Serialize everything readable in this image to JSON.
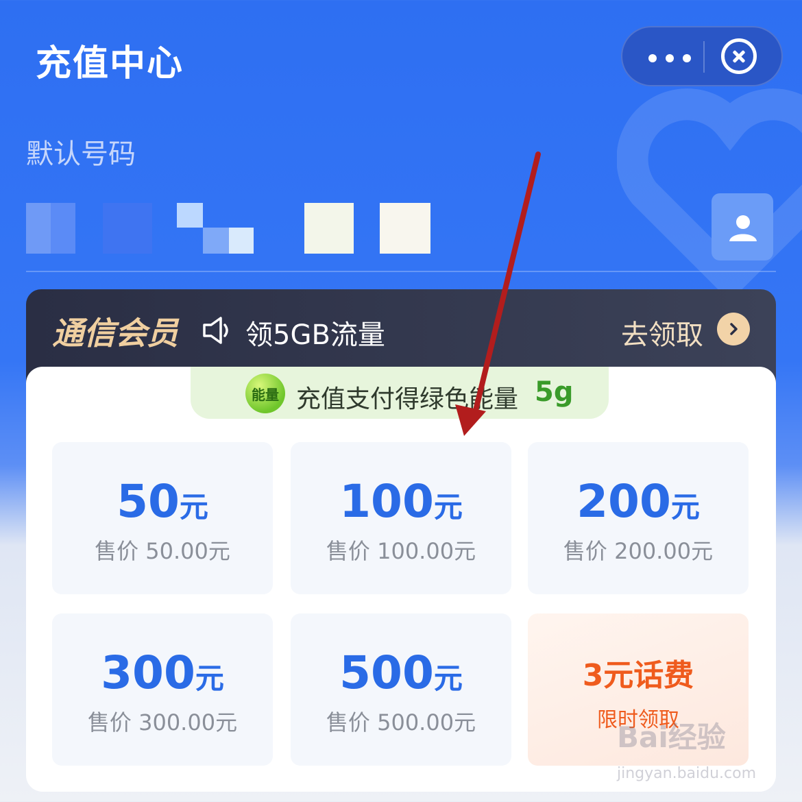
{
  "header": {
    "title": "充值中心"
  },
  "phone": {
    "label": "默认号码"
  },
  "member": {
    "title": "通信会员",
    "promo": "领5GB流量",
    "cta": "去领取"
  },
  "energy": {
    "text": "充值支付得绿色能量",
    "value": "5g",
    "icon_label": "能量"
  },
  "tiles": [
    {
      "amount": "50",
      "unit": "元",
      "price": "售价 50.00元"
    },
    {
      "amount": "100",
      "unit": "元",
      "price": "售价 100.00元"
    },
    {
      "amount": "200",
      "unit": "元",
      "price": "售价 200.00元"
    },
    {
      "amount": "300",
      "unit": "元",
      "price": "售价 300.00元"
    },
    {
      "amount": "500",
      "unit": "元",
      "price": "售价 500.00元"
    }
  ],
  "promo_tile": {
    "title": "3元话费",
    "subtitle": "限时领取"
  },
  "watermark": {
    "text": "Bai经验",
    "url": "jingyan.baidu.com"
  },
  "colors": {
    "primary": "#2e6ff2",
    "amount": "#2a6be6",
    "promo": "#ef5b1d",
    "member_bg": "#2a2e44"
  }
}
